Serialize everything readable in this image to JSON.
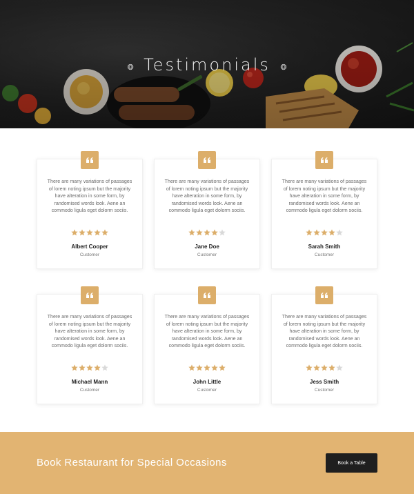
{
  "hero": {
    "title": "Testimonials",
    "deco_left": "❂",
    "deco_right": "❂"
  },
  "colors": {
    "accent": "#dcae6a",
    "cta_background": "#e2b472",
    "button_dark": "#1f1f1f",
    "star_filled": "#dcae6a",
    "star_empty": "#d9d9d9"
  },
  "testimonials": [
    {
      "text": "There are many variations of passages of lorem noting ipsum but the majority have alteration in some form, by randomised words look. Aene an commodo ligula eget dolorm sociis.",
      "rating": 5,
      "max_rating": 5,
      "name": "Albert Cooper",
      "role": "Customer"
    },
    {
      "text": "There are many variations of passages of lorem noting ipsum but the majority have alteration in some form, by randomised words look. Aene an commodo ligula eget dolorm sociis.",
      "rating": 4,
      "max_rating": 5,
      "name": "Jane Doe",
      "role": "Customer"
    },
    {
      "text": "There are many variations of passages of lorem noting ipsum but the majority have alteration in some form, by randomised words look. Aene an commodo ligula eget dolorm sociis.",
      "rating": 4,
      "max_rating": 5,
      "name": "Sarah Smith",
      "role": "Customer"
    },
    {
      "text": "There are many variations of passages of lorem noting ipsum but the majority have alteration in some form, by randomised words look. Aene an commodo ligula eget dolorm sociis.",
      "rating": 4,
      "max_rating": 5,
      "name": "Michael Mann",
      "role": "Customer"
    },
    {
      "text": "There are many variations of passages of lorem noting ipsum but the majority have alteration in some form, by randomised words look. Aene an commodo ligula eget dolorm sociis.",
      "rating": 5,
      "max_rating": 5,
      "name": "John Little",
      "role": "Customer"
    },
    {
      "text": "There are many variations of passages of lorem noting ipsum but the majority have alteration in some form, by randomised words look. Aene an commodo ligula eget dolorm sociis.",
      "rating": 4,
      "max_rating": 5,
      "name": "Jess Smith",
      "role": "Customer"
    }
  ],
  "cta": {
    "text": "Book Restaurant for Special Occasions",
    "button_label": "Book a Table"
  }
}
